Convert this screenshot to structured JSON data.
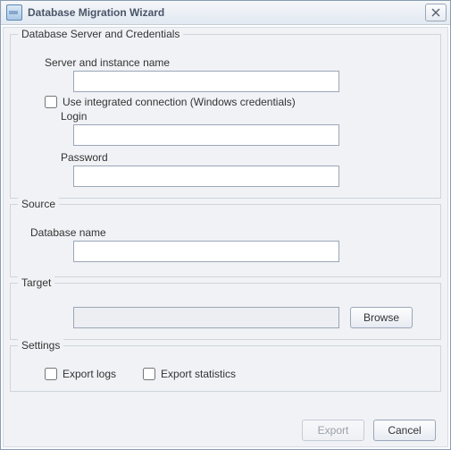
{
  "window": {
    "title": "Database Migration Wizard"
  },
  "groups": {
    "credentials": {
      "title": "Database Server and Credentials",
      "server_label": "Server and instance name",
      "server_value": "",
      "integrated_label": "Use integrated connection (Windows credentials)",
      "integrated_checked": false,
      "login_label": "Login",
      "login_value": "",
      "password_label": "Password",
      "password_value": ""
    },
    "source": {
      "title": "Source",
      "db_name_label": "Database name",
      "db_name_value": ""
    },
    "target": {
      "title": "Target",
      "path_value": "",
      "browse_label": "Browse"
    },
    "settings": {
      "title": "Settings",
      "export_logs_label": "Export logs",
      "export_logs_checked": false,
      "export_stats_label": "Export statistics",
      "export_stats_checked": false
    }
  },
  "footer": {
    "export_label": "Export",
    "cancel_label": "Cancel"
  }
}
